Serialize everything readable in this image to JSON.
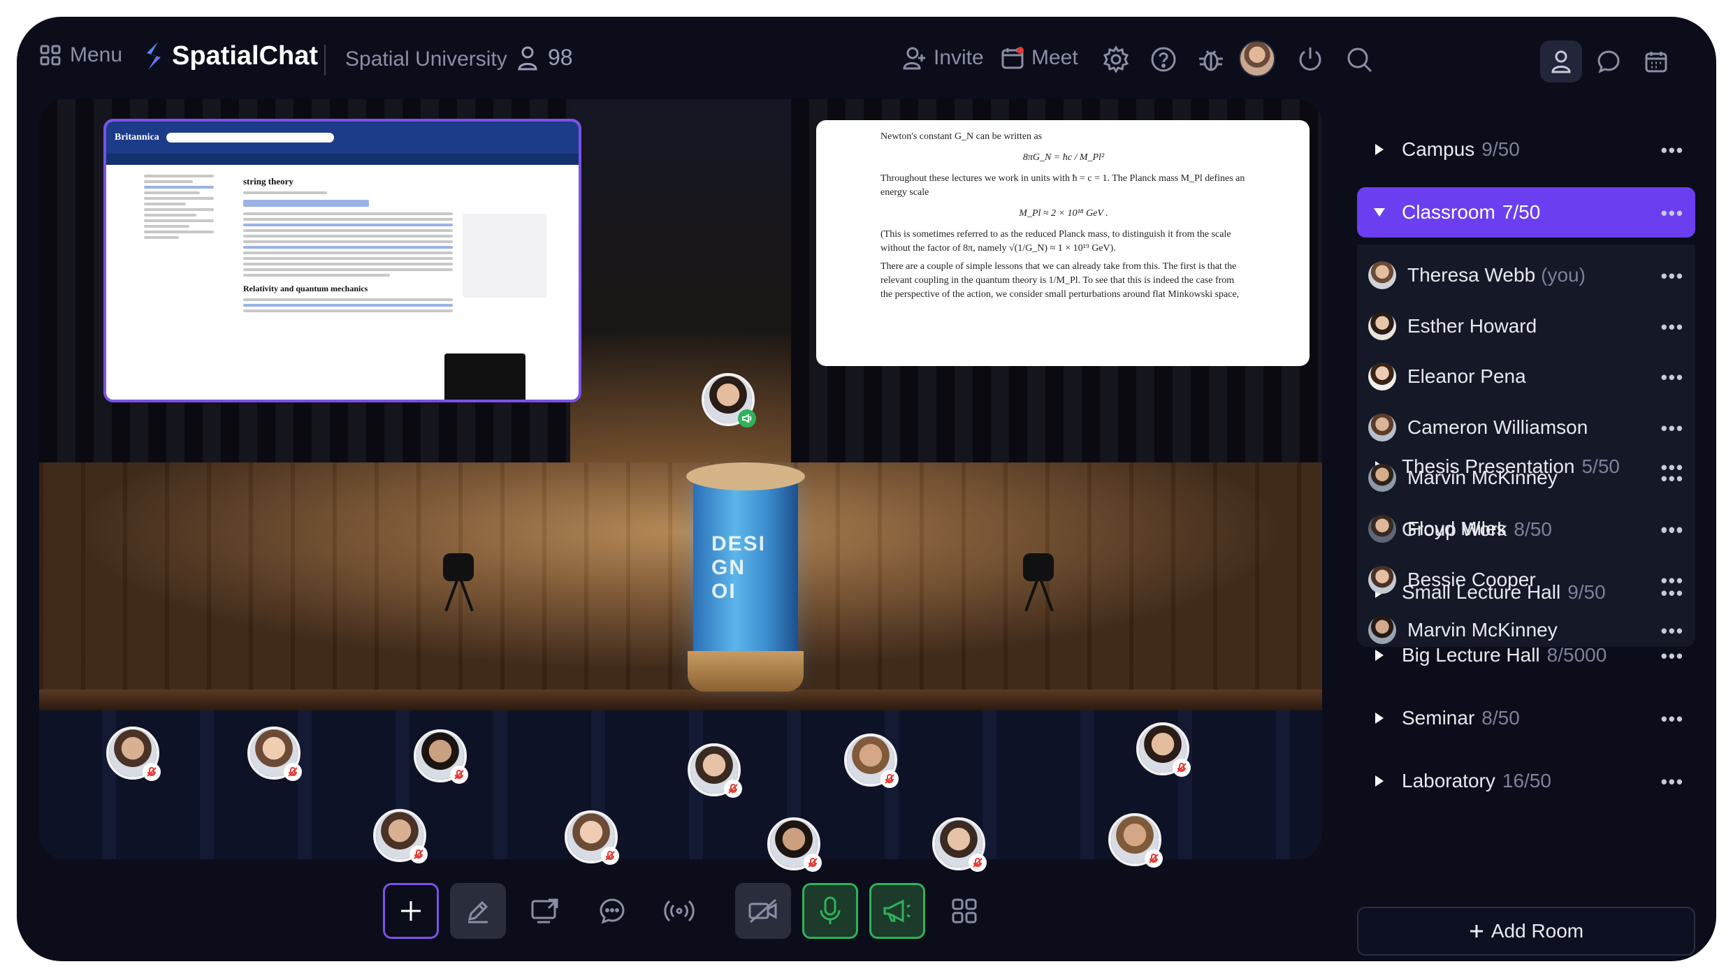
{
  "topbar": {
    "menu_label": "Menu",
    "app_name": "SpatialChat",
    "org_name": "Spatial University",
    "participant_count": "98",
    "invite_label": "Invite",
    "meet_label": "Meet"
  },
  "colors": {
    "accent": "#6b3ff0",
    "background": "#0b0d1a",
    "speaking": "#2fb25a",
    "muted_badge": "#e53935"
  },
  "stage": {
    "podium_text": [
      "DESI",
      "GN",
      "OI"
    ],
    "web_screen": {
      "brand": "Britannica",
      "title": "string theory",
      "section_heading": "Relativity and quantum mechanics"
    },
    "doc_screen": {
      "line1": "Newton's constant G_N can be written as",
      "eq1": "8πG_N = ħc / M_Pl²",
      "line2": "Throughout these lectures we work in units with ħ = c = 1. The Planck mass M_Pl defines an energy scale",
      "eq2": "M_Pl ≈ 2 × 10¹⁸ GeV .",
      "line3": "(This is sometimes referred to as the reduced Planck mass, to distinguish it from the scale without the factor of 8π, namely √(1/G_N) ≈ 1 × 10¹⁹ GeV).",
      "line4": "There are a couple of simple lessons that we can already take from this. The first is that the relevant coupling in the quantum theory is 1/M_Pl. To see that this is indeed the case from the perspective of the action, we consider small perturbations around flat Minkowski space,"
    }
  },
  "rooms": [
    {
      "name": "Campus",
      "capacity": "9/50",
      "active": false
    },
    {
      "name": "Classroom",
      "capacity": "7/50",
      "active": true
    },
    {
      "name": "Thesis Presentation",
      "capacity": "5/50",
      "active": false
    },
    {
      "name": "Group Work",
      "capacity": "8/50",
      "active": false
    },
    {
      "name": "Small Lecture Hall",
      "capacity": "9/50",
      "active": false
    },
    {
      "name": "Big Lecture Hall",
      "capacity": "8/5000",
      "active": false
    },
    {
      "name": "Seminar",
      "capacity": "8/50",
      "active": false
    },
    {
      "name": "Laboratory",
      "capacity": "16/50",
      "active": false
    }
  ],
  "members": [
    {
      "name": "Theresa Webb",
      "suffix": "(you)"
    },
    {
      "name": "Esther Howard",
      "suffix": ""
    },
    {
      "name": "Eleanor Pena",
      "suffix": ""
    },
    {
      "name": "Cameron Williamson",
      "suffix": ""
    },
    {
      "name": "Marvin McKinney",
      "suffix": ""
    },
    {
      "name": "Floyd Miles",
      "suffix": ""
    },
    {
      "name": "Bessie Cooper",
      "suffix": ""
    },
    {
      "name": "Marvin McKinney",
      "suffix": ""
    }
  ],
  "add_room_label": "Add Room",
  "more_glyph": "•••"
}
